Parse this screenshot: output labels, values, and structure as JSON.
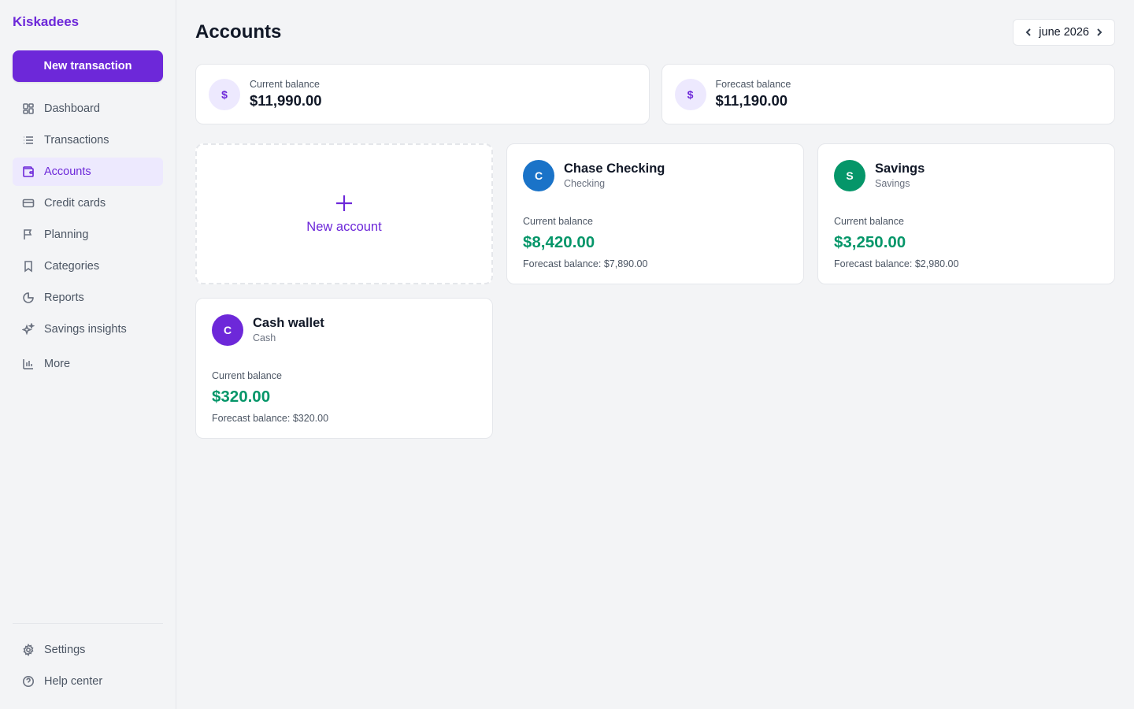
{
  "app": {
    "name": "Kiskadees"
  },
  "sidebar": {
    "new_transaction_label": "New transaction",
    "items": [
      {
        "label": "Dashboard",
        "icon": "dashboard-icon"
      },
      {
        "label": "Transactions",
        "icon": "list-icon"
      },
      {
        "label": "Accounts",
        "icon": "wallet-icon",
        "active": true
      },
      {
        "label": "Credit cards",
        "icon": "credit-card-icon"
      },
      {
        "label": "Planning",
        "icon": "flag-icon"
      },
      {
        "label": "Categories",
        "icon": "bookmark-icon"
      },
      {
        "label": "Reports",
        "icon": "pie-chart-icon"
      },
      {
        "label": "Savings insights",
        "icon": "sparkles-icon"
      },
      {
        "label": "More",
        "icon": "bar-chart-icon"
      }
    ],
    "bottom_items": [
      {
        "label": "Settings",
        "icon": "gear-icon"
      },
      {
        "label": "Help center",
        "icon": "help-circle-icon"
      }
    ]
  },
  "header": {
    "title": "Accounts",
    "month": "june 2026"
  },
  "summary": {
    "current": {
      "label": "Current balance",
      "value": "$11,990.00",
      "icon_glyph": "$"
    },
    "forecast": {
      "label": "Forecast balance",
      "value": "$11,190.00",
      "icon_glyph": "$"
    }
  },
  "new_account_label": "New account",
  "accounts": [
    {
      "initial": "C",
      "name": "Chase Checking",
      "type": "Checking",
      "color": "#1a73c8",
      "balance_label": "Current balance",
      "balance": "$8,420.00",
      "forecast": "Forecast balance: $7,890.00"
    },
    {
      "initial": "S",
      "name": "Savings",
      "type": "Savings",
      "color": "#059669",
      "balance_label": "Current balance",
      "balance": "$3,250.00",
      "forecast": "Forecast balance: $2,980.00"
    },
    {
      "initial": "C",
      "name": "Cash wallet",
      "type": "Cash",
      "color": "#6d28d9",
      "balance_label": "Current balance",
      "balance": "$320.00",
      "forecast": "Forecast balance: $320.00"
    }
  ],
  "colors": {
    "accent": "#6d28d9",
    "positive": "#059669"
  }
}
